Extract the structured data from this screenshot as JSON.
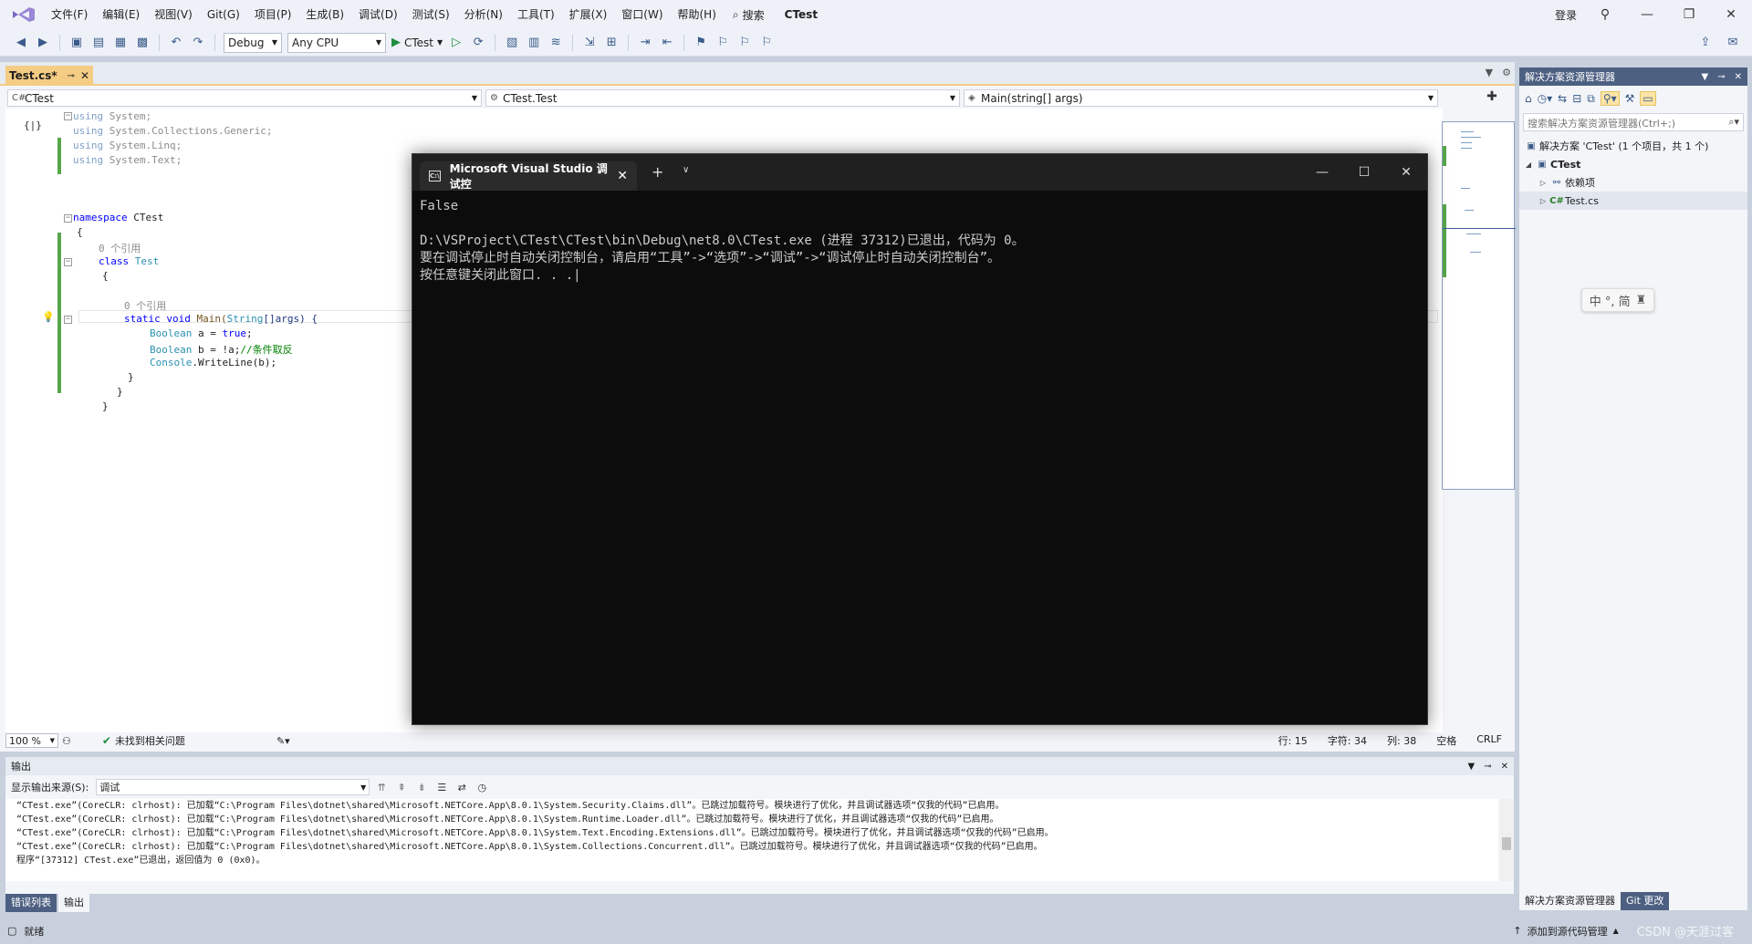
{
  "menu": {
    "items": [
      "文件(F)",
      "编辑(E)",
      "视图(V)",
      "Git(G)",
      "项目(P)",
      "生成(B)",
      "调试(D)",
      "测试(S)",
      "分析(N)",
      "工具(T)",
      "扩展(X)",
      "窗口(W)",
      "帮助(H)"
    ],
    "search_label": "搜索",
    "app_title": "CTest",
    "login": "登录"
  },
  "toolbar": {
    "config": "Debug",
    "platform": "Any CPU",
    "run_label": "CTest"
  },
  "doc_tab": {
    "title": "Test.cs*"
  },
  "navbar": {
    "project": "CTest",
    "class": "CTest.Test",
    "member": "Main(string[] args)"
  },
  "code": {
    "l1_kw": "using",
    "l1_rest": " System;",
    "l2_kw": "using",
    "l2_rest": " System.Collections.Generic;",
    "l3_kw": "using",
    "l3_rest": " System.Linq;",
    "l4_kw": "using",
    "l4_rest": " System.Text;",
    "ns_kw": "namespace",
    "ns_name": " CTest",
    "brace_open": "{",
    "brace_close": "}",
    "refs0": "0 个引用",
    "class_kw": "class",
    "class_name": " Test",
    "static_kw": "static",
    "void_kw": " void",
    "main_name": " Main(",
    "string_t": "String",
    "args_part": "[]args) {",
    "bool_t": "Boolean",
    "stmt1_rest": " a = ",
    "true_kw": "true",
    "semicolon": ";",
    "stmt2_rest": " b = !a;",
    "comment": "//条件取反",
    "console_t": "Console",
    "writeline": ".WriteLine(b);"
  },
  "console": {
    "tab_title": "Microsoft Visual Studio 调试控",
    "lines": [
      "False",
      "",
      "D:\\VSProject\\CTest\\CTest\\bin\\Debug\\net8.0\\CTest.exe (进程 37312)已退出，代码为 0。",
      "要在调试停止时自动关闭控制台，请启用“工具”->“选项”->“调试”->“调试停止时自动关闭控制台”。",
      "按任意键关闭此窗口. . ."
    ]
  },
  "editor_status": {
    "zoom": "100 %",
    "issues": "未找到相关问题",
    "line": "行: 15",
    "char": "字符: 34",
    "col": "列: 38",
    "space": "空格",
    "eol": "CRLF"
  },
  "solution": {
    "title": "解决方案资源管理器",
    "search_placeholder": "搜索解决方案资源管理器(Ctrl+;)",
    "root": "解决方案 'CTest' (1 个项目，共 1 个)",
    "project": "CTest",
    "deps": "依赖项",
    "file": "Test.cs",
    "ime": "中 °, 简",
    "tab_explorer": "解决方案资源管理器",
    "tab_git": "Git 更改"
  },
  "output": {
    "title": "输出",
    "source_label": "显示输出来源(S):",
    "source_value": "调试",
    "lines": [
      "“CTest.exe”(CoreCLR: clrhost): 已加载“C:\\Program Files\\dotnet\\shared\\Microsoft.NETCore.App\\8.0.1\\System.Security.Claims.dll”。已跳过加载符号。模块进行了优化，并且调试器选项“仅我的代码”已启用。",
      "“CTest.exe”(CoreCLR: clrhost): 已加载“C:\\Program Files\\dotnet\\shared\\Microsoft.NETCore.App\\8.0.1\\System.Runtime.Loader.dll”。已跳过加载符号。模块进行了优化，并且调试器选项“仅我的代码”已启用。",
      "“CTest.exe”(CoreCLR: clrhost): 已加载“C:\\Program Files\\dotnet\\shared\\Microsoft.NETCore.App\\8.0.1\\System.Text.Encoding.Extensions.dll”。已跳过加载符号。模块进行了优化，并且调试器选项“仅我的代码”已启用。",
      "“CTest.exe”(CoreCLR: clrhost): 已加载“C:\\Program Files\\dotnet\\shared\\Microsoft.NETCore.App\\8.0.1\\System.Collections.Concurrent.dll”。已跳过加载符号。模块进行了优化，并且调试器选项“仅我的代码”已启用。",
      "程序“[37312] CTest.exe”已退出，返回值为 0 (0x0)。"
    ]
  },
  "bottom_tabs": {
    "errors": "错误列表",
    "output": "输出"
  },
  "status": {
    "ready": "就绪",
    "source_control": "添加到源代码管理",
    "watermark": "CSDN @天涯过客"
  },
  "colors": {
    "accent": "#f5cc84",
    "panel_header": "#4d6082",
    "console_bg": "#0c0c0c"
  }
}
